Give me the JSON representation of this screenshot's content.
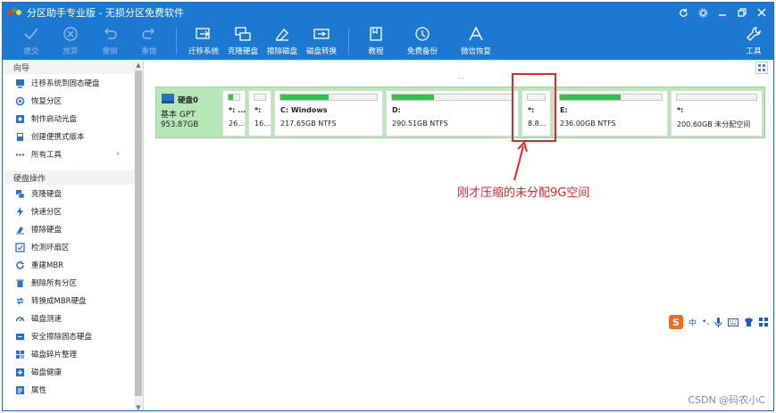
{
  "window": {
    "title": "分区助手专业版 - 无损分区免费软件"
  },
  "toolbar": {
    "buttons": [
      {
        "label": "提交",
        "icon": "check-icon",
        "enabled": false
      },
      {
        "label": "放弃",
        "icon": "discard-icon",
        "enabled": false
      },
      {
        "label": "撤销",
        "icon": "undo-icon",
        "enabled": false
      },
      {
        "label": "重做",
        "icon": "redo-icon",
        "enabled": false
      },
      {
        "label": "迁移系统",
        "icon": "migrate-os-icon",
        "enabled": true
      },
      {
        "label": "克隆硬盘",
        "icon": "clone-disk-icon",
        "enabled": true
      },
      {
        "label": "擦除磁盘",
        "icon": "wipe-disk-icon",
        "enabled": true
      },
      {
        "label": "磁盘转换",
        "icon": "convert-disk-icon",
        "enabled": true
      },
      {
        "label": "教程",
        "icon": "tutorial-icon",
        "enabled": true
      },
      {
        "label": "免费备份",
        "icon": "backup-icon",
        "enabled": true
      },
      {
        "label": "微信恢复",
        "icon": "recovery-icon",
        "enabled": true
      },
      {
        "label": "工具",
        "icon": "tools-icon",
        "enabled": true
      }
    ]
  },
  "sidebar": {
    "wizard_title": "向导",
    "wizard_items": [
      {
        "label": "迁移系统到固态硬盘",
        "icon": "migrate-icon"
      },
      {
        "label": "恢复分区",
        "icon": "restore-icon"
      },
      {
        "label": "制作启动光盘",
        "icon": "boot-disc-icon"
      },
      {
        "label": "创建便携式版本",
        "icon": "portable-icon"
      },
      {
        "label": "所有工具",
        "icon": "more-icon"
      }
    ],
    "disk_ops_title": "硬盘操作",
    "disk_items": [
      {
        "label": "克隆硬盘",
        "icon": "clone-icon"
      },
      {
        "label": "快速分区",
        "icon": "lightning-icon"
      },
      {
        "label": "擦除硬盘",
        "icon": "eraser-icon"
      },
      {
        "label": "检测坏扇区",
        "icon": "check-sector-icon"
      },
      {
        "label": "重建MBR",
        "icon": "rebuild-mbr-icon"
      },
      {
        "label": "删除所有分区",
        "icon": "trash-icon"
      },
      {
        "label": "转换成MBR硬盘",
        "icon": "convert-icon"
      },
      {
        "label": "磁盘测速",
        "icon": "speed-icon"
      },
      {
        "label": "安全擦除固态硬盘",
        "icon": "ssd-erase-icon"
      },
      {
        "label": "磁盘碎片整理",
        "icon": "defrag-icon"
      },
      {
        "label": "磁盘健康",
        "icon": "health-icon"
      },
      {
        "label": "属性",
        "icon": "properties-icon"
      }
    ]
  },
  "disk": {
    "name": "硬盘0",
    "type": "基本 GPT",
    "size": "953.87GB",
    "partitions": [
      {
        "name": "*: ...",
        "info": "26...",
        "used": 0.4
      },
      {
        "name": "*:",
        "info": "16...",
        "used": 0.0
      },
      {
        "name": "C: Windows",
        "info": "217.65GB NTFS",
        "used": 0.5
      },
      {
        "name": "D:",
        "info": "290.51GB NTFS",
        "used": 0.35
      },
      {
        "name": "*:",
        "info": "8.8...",
        "used": 0.0
      },
      {
        "name": "E:",
        "info": "236.00GB NTFS",
        "used": 0.6
      },
      {
        "name": "*:",
        "info": "200.60GB 未分配空间",
        "used": 0.0
      }
    ]
  },
  "annotation": {
    "text": "刚才压缩的未分配9G空间"
  },
  "ime": {
    "logo": "S",
    "mode": "中"
  },
  "watermark": "CSDN @码农小C",
  "colors": {
    "titlebar": "#1d78d2",
    "disk_row": "#b8e7b7",
    "used_fill": "#33c34a",
    "annotation": "#e5262a"
  }
}
